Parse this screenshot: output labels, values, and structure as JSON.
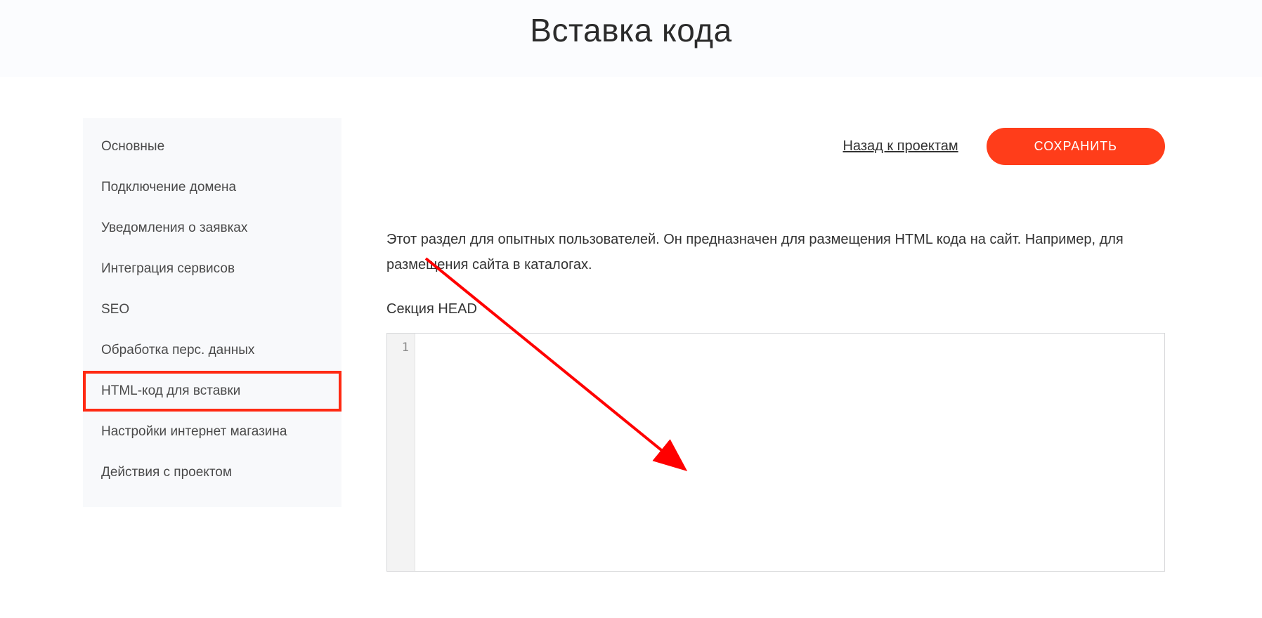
{
  "header": {
    "title": "Вставка кода"
  },
  "sidebar": {
    "items": [
      {
        "label": "Основные"
      },
      {
        "label": "Подключение домена"
      },
      {
        "label": "Уведомления о заявках"
      },
      {
        "label": "Интеграция сервисов"
      },
      {
        "label": "SEO"
      },
      {
        "label": "Обработка перс. данных"
      },
      {
        "label": "HTML-код для вставки"
      },
      {
        "label": "Настройки интернет магазина"
      },
      {
        "label": "Действия с проектом"
      }
    ],
    "active_index": 6
  },
  "actions": {
    "back_label": "Назад к проектам",
    "save_label": "СОХРАНИТЬ"
  },
  "main": {
    "description": "Этот раздел для опытных пользователей. Он предназначен для размещения HTML кода на сайт. Например, для размещения сайта в каталогах.",
    "section_head_label": "Секция HEAD",
    "editor_line_number": "1",
    "editor_value": ""
  },
  "annotation": {
    "highlight_sidebar_index": 6,
    "arrow_color": "#ff0000"
  }
}
